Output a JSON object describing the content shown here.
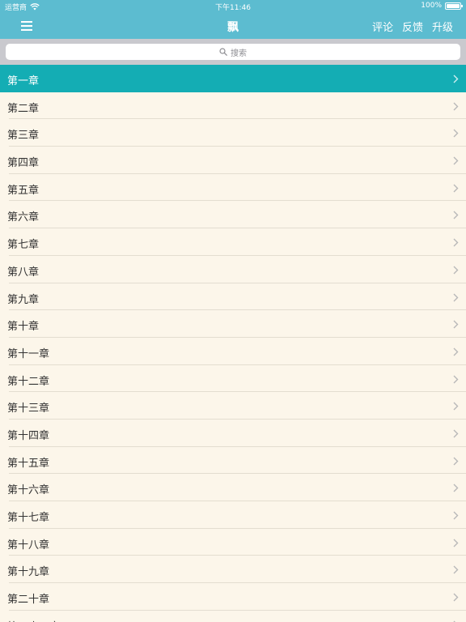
{
  "status_bar": {
    "carrier": "运营商",
    "time": "下午11:46",
    "battery": "100%"
  },
  "nav": {
    "title": "飘",
    "actions": [
      "评论",
      "反馈",
      "升级"
    ]
  },
  "search": {
    "placeholder": "搜索"
  },
  "chapters": [
    "第一章",
    "第二章",
    "第三章",
    "第四章",
    "第五章",
    "第六章",
    "第七章",
    "第八章",
    "第九章",
    "第十章",
    "第十一章",
    "第十二章",
    "第十三章",
    "第十四章",
    "第十五章",
    "第十六章",
    "第十七章",
    "第十八章",
    "第十九章",
    "第二十章",
    "第二十一章"
  ],
  "selected_index": 0,
  "colors": {
    "header": "#5cbcd0",
    "selected_row": "#14adb4",
    "list_background": "#fcf6ea"
  },
  "icons": {
    "menu": "menu-icon",
    "wifi": "wifi-icon",
    "battery": "battery-icon",
    "search": "search-icon",
    "chevron": "chevron-right-icon"
  }
}
